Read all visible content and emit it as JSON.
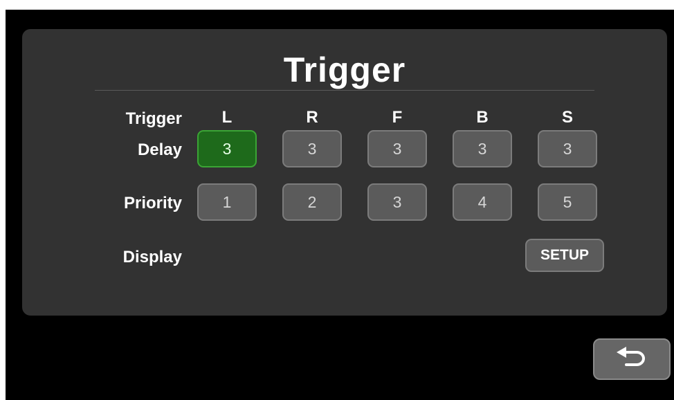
{
  "title": "Trigger",
  "row_labels": {
    "trigger": "Trigger",
    "delay": "Delay",
    "priority": "Priority",
    "display": "Display"
  },
  "columns": [
    "L",
    "R",
    "F",
    "B",
    "S"
  ],
  "delay_values": [
    "3",
    "3",
    "3",
    "3",
    "3"
  ],
  "priority_values": [
    "1",
    "2",
    "3",
    "4",
    "5"
  ],
  "selected_delay": "L",
  "setup_label": "SETUP",
  "icons": {
    "back": "return-arrow-icon"
  },
  "colors": {
    "accent": "#1e6a1b",
    "panel": "#323232",
    "button": "#5b5b5b"
  }
}
